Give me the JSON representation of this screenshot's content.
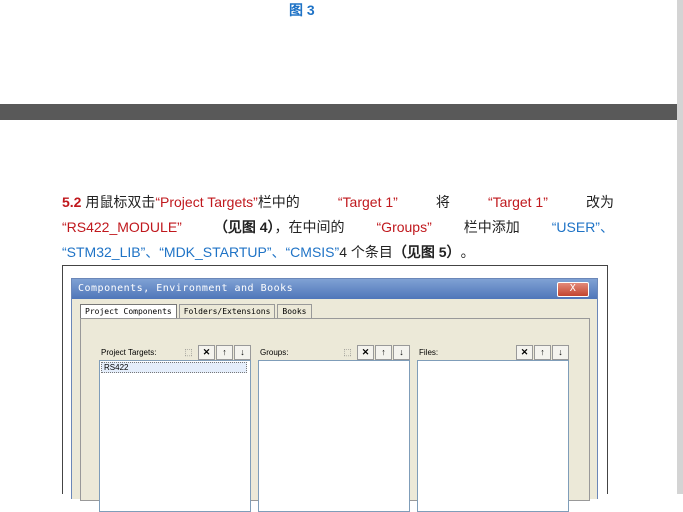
{
  "figure_caption": "图 3",
  "paragraph": {
    "line1": {
      "num": "5.2",
      "t1": "用鼠标双击",
      "q1": "“Project Targets”",
      "t2": "栏中的",
      "q2": "“Target 1”",
      "t3": "将",
      "q3": "“Target 1”",
      "t4": "改为"
    },
    "line2": {
      "q1": "“RS422_MODULE”",
      "b1": "（见图 4）",
      "t1": "，在中间的",
      "q2": "“Groups”",
      "t2": "栏中添加",
      "q3": "“USER”、"
    },
    "line3": {
      "q1": "“STM32_LIB”、“MDK_STARTUP”、“CMSIS”",
      "t1": "4 个条目",
      "b1": "（见图 5）",
      "t2": "。"
    }
  },
  "dialog": {
    "title": "Components, Environment and Books",
    "close_label": "X",
    "tabs": [
      "Project Components",
      "Folders/Extensions",
      "Books"
    ],
    "columns": [
      {
        "label": "Project Targets:",
        "items": [
          "RS422"
        ]
      },
      {
        "label": "Groups:",
        "items": []
      },
      {
        "label": "Files:",
        "items": []
      }
    ],
    "buttons": {
      "new": "⬚",
      "delete": "✕",
      "up": "↑",
      "down": "↓"
    }
  },
  "colors": {
    "accent_red": "#c0181d",
    "accent_blue": "#1f73c6",
    "page_gap": "#595959"
  }
}
